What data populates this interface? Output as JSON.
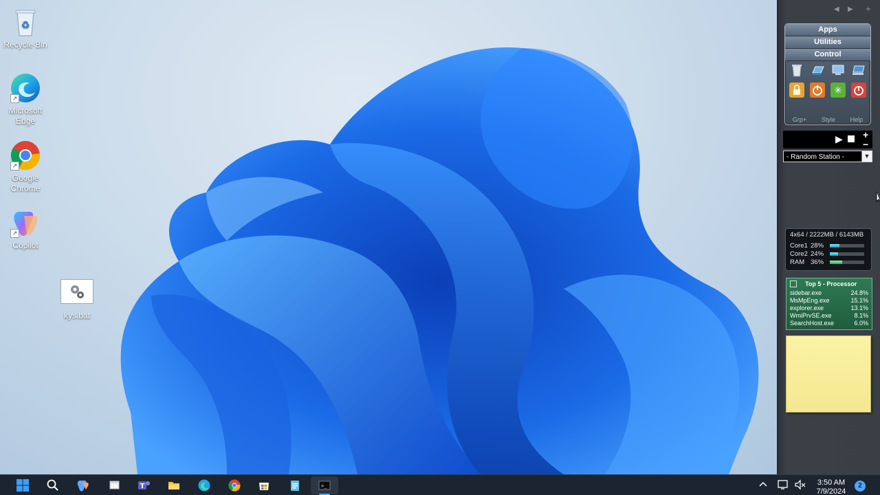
{
  "desktop": {
    "icons": [
      {
        "label": "Recycle Bin"
      },
      {
        "label": "Microsoft Edge"
      },
      {
        "label": "Google Chrome"
      },
      {
        "label": "Copilot"
      },
      {
        "label": "kys.bat"
      }
    ]
  },
  "sidebar": {
    "launcher": {
      "tabs": [
        "Apps",
        "Utilities",
        "Control"
      ],
      "footer": [
        "Grp+",
        "Style",
        "Help"
      ]
    },
    "radio": {
      "station": "- Random Station -"
    },
    "cpu_meter": {
      "header": "4x64 / 2222MB / 6143MB",
      "rows": [
        {
          "label": "Core1",
          "value": "28%",
          "level": 0.28
        },
        {
          "label": "Core2",
          "value": "24%",
          "level": 0.24
        },
        {
          "label": "RAM",
          "value": "36%",
          "level": 0.36
        }
      ]
    },
    "top5": {
      "title": "Top 5 - Processor",
      "rows": [
        {
          "name": "sidebar.exe",
          "pct": "24.8%"
        },
        {
          "name": "MsMpEng.exe",
          "pct": "15.1%"
        },
        {
          "name": "explorer.exe",
          "pct": "13.1%"
        },
        {
          "name": "WmiPrvSE.exe",
          "pct": "8.1%"
        },
        {
          "name": "SearchHost.exe",
          "pct": "6.0%"
        }
      ]
    }
  },
  "taskbar": {
    "time": "3:50 AM",
    "date": "7/9/2024",
    "notification_count": "2",
    "pinned": [
      "start-icon",
      "search-icon",
      "copilot-icon",
      "task-view-icon",
      "teams-icon",
      "file-explorer-icon",
      "edge-icon",
      "chrome-icon",
      "store-icon",
      "notepad-icon",
      "terminal-icon"
    ]
  },
  "colors": {
    "wallpaper_blue": "#1f6fe5",
    "taskbar_bg": "#1c2430",
    "sidebar_bg": "#3a3f46",
    "note_yellow": "#f8ee9c",
    "top5_green": "#2f7a53"
  }
}
